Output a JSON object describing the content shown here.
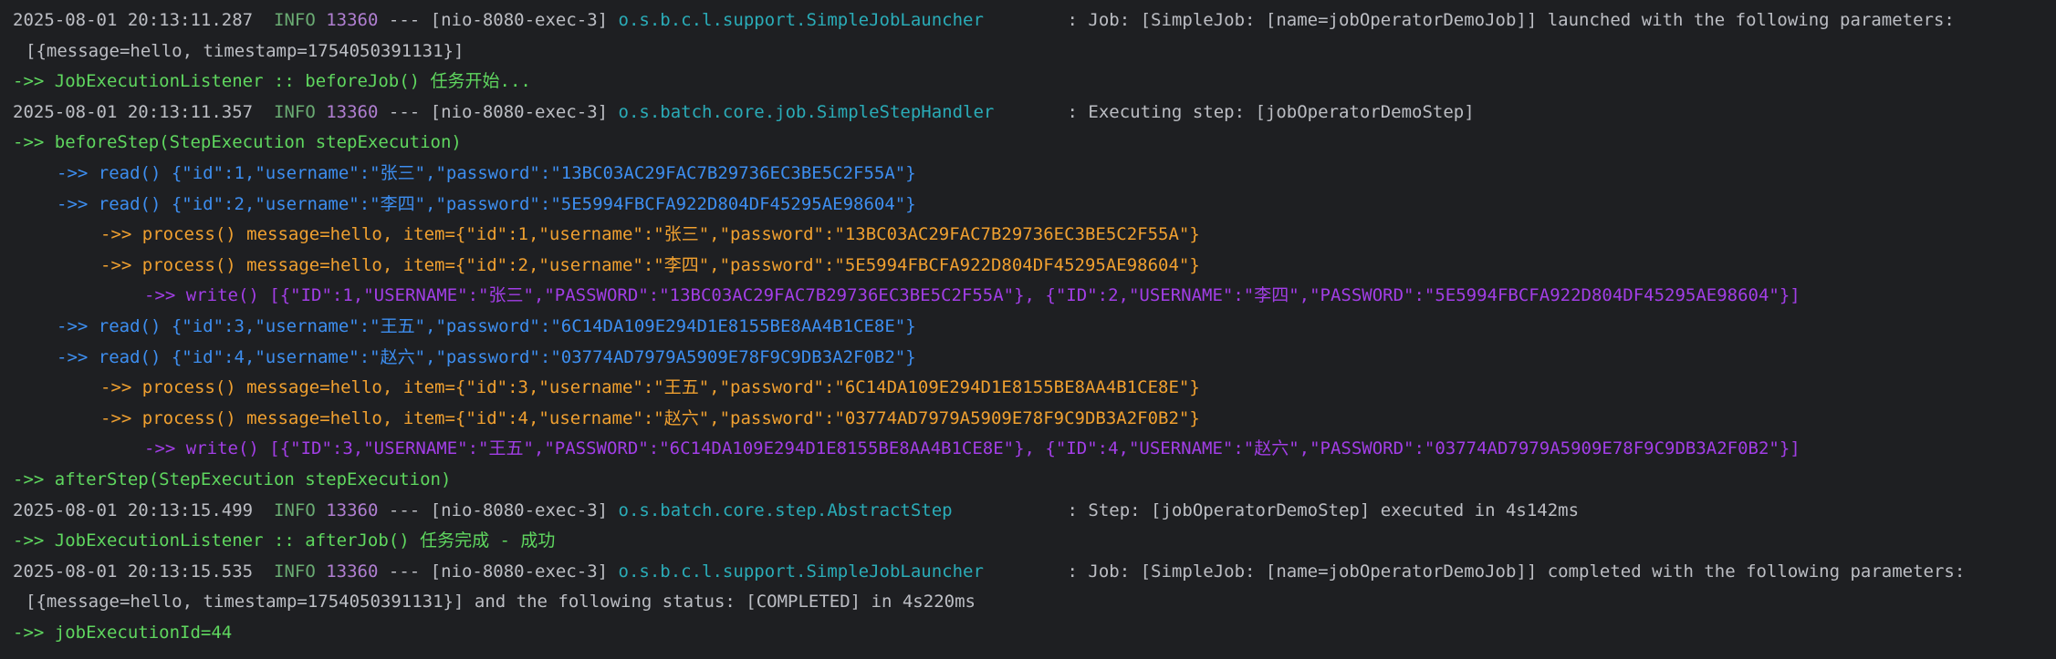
{
  "colors": {
    "background": "#1e1f22",
    "timestamp": "#bcbec4",
    "level_info": "#6aab73",
    "pid": "#b07fd1",
    "logger": "#2aacb8",
    "listener_green": "#5fd75f",
    "read_blue": "#3d8ef0",
    "process_orange": "#f0a030",
    "write_purple": "#a23ee6"
  },
  "log": {
    "line1": {
      "ts": "2025-08-01 20:13:11.287",
      "level": "INFO",
      "pid": "13360",
      "thread": "--- [nio-8080-exec-3]",
      "logger": "o.s.b.c.l.support.SimpleJobLauncher",
      "msg": ": Job: [SimpleJob: [name=jobOperatorDemoJob]] launched with the following parameters:"
    },
    "line2": "[{message=hello, timestamp=1754050391131}]",
    "line3": "->> JobExecutionListener :: beforeJob() 任务开始...",
    "line4": {
      "ts": "2025-08-01 20:13:11.357",
      "level": "INFO",
      "pid": "13360",
      "thread": "--- [nio-8080-exec-3]",
      "logger": "o.s.batch.core.job.SimpleStepHandler",
      "msg": ": Executing step: [jobOperatorDemoStep]"
    },
    "line5": "->> beforeStep(StepExecution stepExecution)",
    "line6": "->> read() {\"id\":1,\"username\":\"张三\",\"password\":\"13BC03AC29FAC7B29736EC3BE5C2F55A\"}",
    "line7": "->> read() {\"id\":2,\"username\":\"李四\",\"password\":\"5E5994FBCFA922D804DF45295AE98604\"}",
    "line8": "->> process() message=hello, item={\"id\":1,\"username\":\"张三\",\"password\":\"13BC03AC29FAC7B29736EC3BE5C2F55A\"}",
    "line9": "->> process() message=hello, item={\"id\":2,\"username\":\"李四\",\"password\":\"5E5994FBCFA922D804DF45295AE98604\"}",
    "line10": "->> write() [{\"ID\":1,\"USERNAME\":\"张三\",\"PASSWORD\":\"13BC03AC29FAC7B29736EC3BE5C2F55A\"}, {\"ID\":2,\"USERNAME\":\"李四\",\"PASSWORD\":\"5E5994FBCFA922D804DF45295AE98604\"}]",
    "line11": "->> read() {\"id\":3,\"username\":\"王五\",\"password\":\"6C14DA109E294D1E8155BE8AA4B1CE8E\"}",
    "line12": "->> read() {\"id\":4,\"username\":\"赵六\",\"password\":\"03774AD7979A5909E78F9C9DB3A2F0B2\"}",
    "line13": "->> process() message=hello, item={\"id\":3,\"username\":\"王五\",\"password\":\"6C14DA109E294D1E8155BE8AA4B1CE8E\"}",
    "line14": "->> process() message=hello, item={\"id\":4,\"username\":\"赵六\",\"password\":\"03774AD7979A5909E78F9C9DB3A2F0B2\"}",
    "line15": "->> write() [{\"ID\":3,\"USERNAME\":\"王五\",\"PASSWORD\":\"6C14DA109E294D1E8155BE8AA4B1CE8E\"}, {\"ID\":4,\"USERNAME\":\"赵六\",\"PASSWORD\":\"03774AD7979A5909E78F9C9DB3A2F0B2\"}]",
    "line16": "->> afterStep(StepExecution stepExecution)",
    "line17": {
      "ts": "2025-08-01 20:13:15.499",
      "level": "INFO",
      "pid": "13360",
      "thread": "--- [nio-8080-exec-3]",
      "logger": "o.s.batch.core.step.AbstractStep",
      "msg": ": Step: [jobOperatorDemoStep] executed in 4s142ms"
    },
    "line18": "->> JobExecutionListener :: afterJob() 任务完成 - 成功",
    "line19": {
      "ts": "2025-08-01 20:13:15.535",
      "level": "INFO",
      "pid": "13360",
      "thread": "--- [nio-8080-exec-3]",
      "logger": "o.s.b.c.l.support.SimpleJobLauncher",
      "msg": ": Job: [SimpleJob: [name=jobOperatorDemoJob]] completed with the following parameters:"
    },
    "line20": "[{message=hello, timestamp=1754050391131}] and the following status: [COMPLETED] in 4s220ms",
    "line21": "->> jobExecutionId=44"
  }
}
